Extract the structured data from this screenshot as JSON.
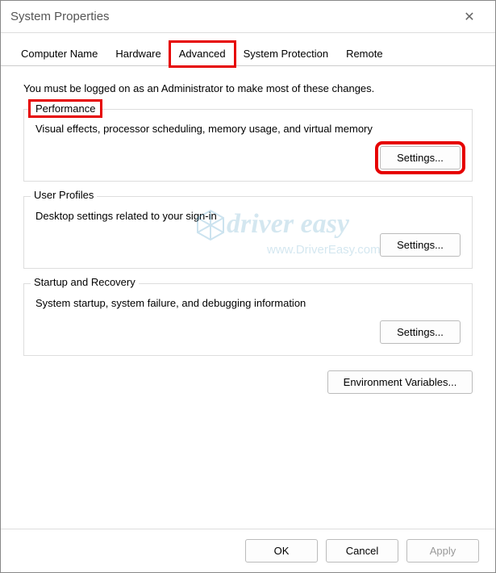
{
  "window": {
    "title": "System Properties"
  },
  "tabs": {
    "computer_name": "Computer Name",
    "hardware": "Hardware",
    "advanced": "Advanced",
    "system_protection": "System Protection",
    "remote": "Remote"
  },
  "advanced_panel": {
    "admin_note": "You must be logged on as an Administrator to make most of these changes.",
    "performance": {
      "legend": "Performance",
      "description": "Visual effects, processor scheduling, memory usage, and virtual memory",
      "settings_button": "Settings..."
    },
    "user_profiles": {
      "legend": "User Profiles",
      "description": "Desktop settings related to your sign-in",
      "settings_button": "Settings..."
    },
    "startup_recovery": {
      "legend": "Startup and Recovery",
      "description": "System startup, system failure, and debugging information",
      "settings_button": "Settings..."
    },
    "env_vars_button": "Environment Variables..."
  },
  "footer": {
    "ok": "OK",
    "cancel": "Cancel",
    "apply": "Apply"
  },
  "watermark": {
    "brand": "driver easy",
    "url": "www.DriverEasy.com"
  }
}
